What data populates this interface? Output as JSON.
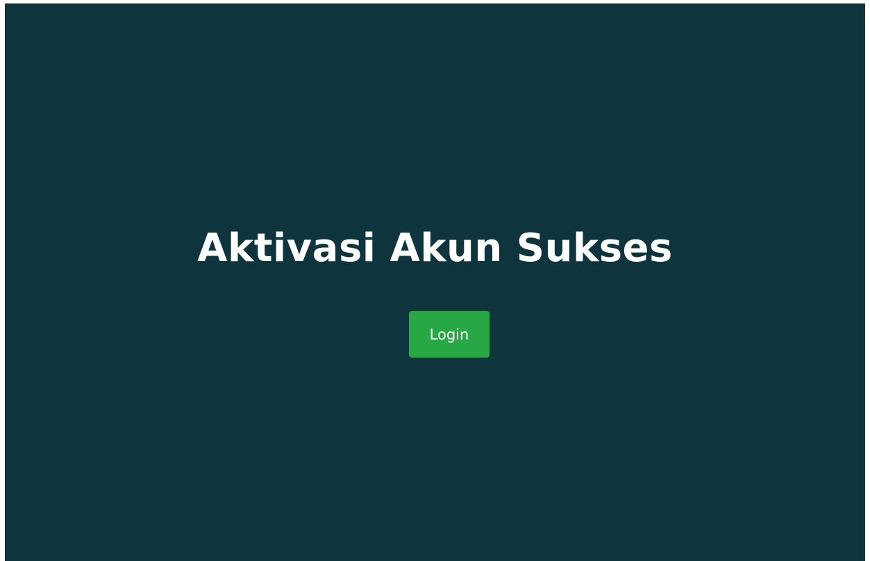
{
  "page": {
    "title": "Aktivasi Akun Sukses",
    "login_label": "Login"
  },
  "colors": {
    "background": "#0e343d",
    "button": "#28a745",
    "text": "#ffffff"
  }
}
